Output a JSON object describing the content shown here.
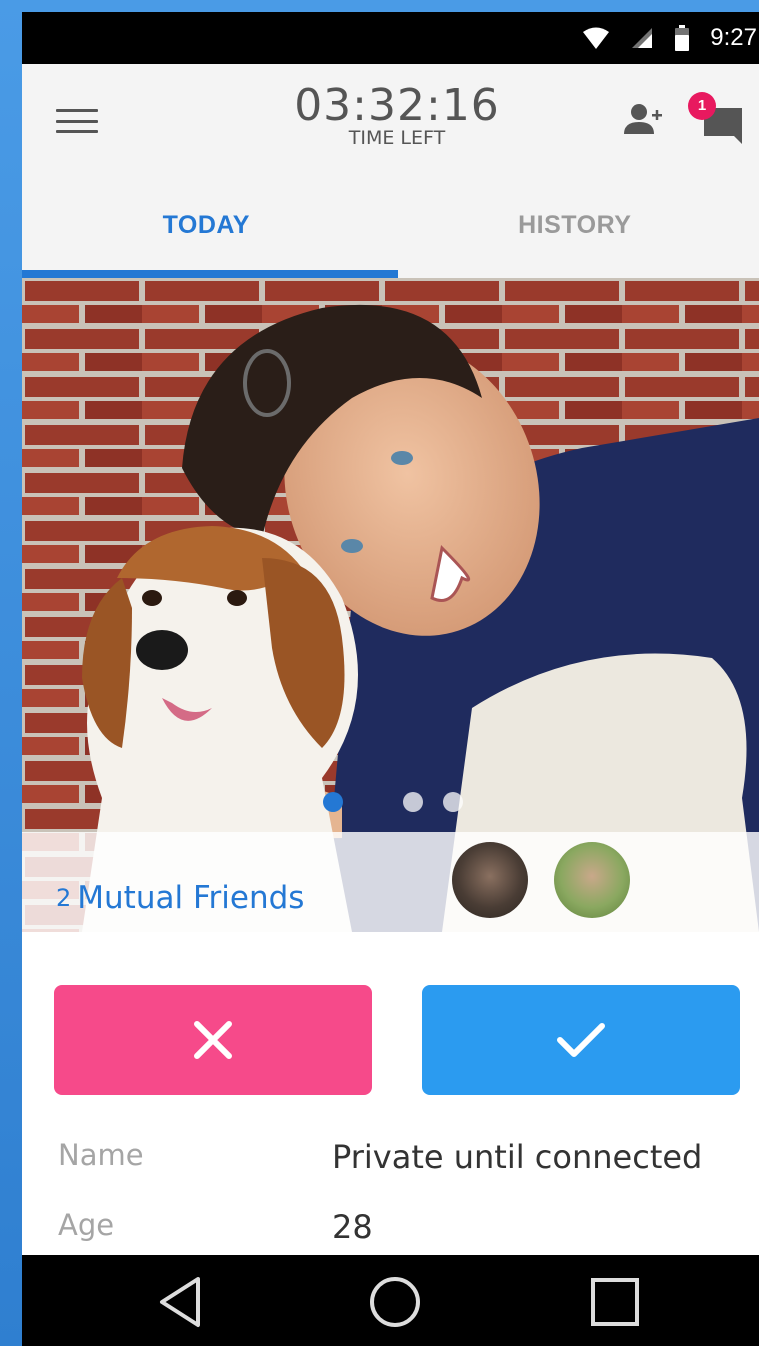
{
  "status_bar": {
    "time": "9:27",
    "icons": [
      "wifi-icon",
      "signal-icon",
      "battery-icon"
    ]
  },
  "header": {
    "timer_value": "03:32:16",
    "timer_label": "TIME LEFT",
    "notification_count": "1",
    "icons": [
      "menu-icon",
      "add-friend-icon",
      "chat-icon"
    ]
  },
  "tabs": [
    {
      "label": "TODAY",
      "active": true
    },
    {
      "label": "HISTORY",
      "active": false
    }
  ],
  "photo": {
    "page_count": 3,
    "current_page": 1
  },
  "mutual": {
    "count": "2",
    "label": "Mutual Friends"
  },
  "actions": {
    "reject_icon": "close-icon",
    "accept_icon": "check-icon"
  },
  "details": [
    {
      "label": "Name",
      "value": "Private until connected"
    },
    {
      "label": "Age",
      "value": "28"
    }
  ],
  "navigation": [
    "back-icon",
    "home-icon",
    "recents-icon"
  ],
  "colors": {
    "accent_blue": "#2478d4",
    "reject_pink": "#f64a8a",
    "accept_blue": "#2b9bf0",
    "badge_red": "#e8195f"
  }
}
